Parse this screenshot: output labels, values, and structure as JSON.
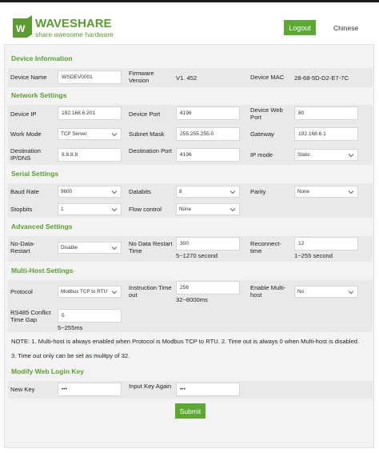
{
  "brand": {
    "name": "WAVESHARE",
    "tagline": "share awesome hardware",
    "color": "#5a9e2f"
  },
  "header": {
    "logout_label": "Logout",
    "language_label": "Chinese"
  },
  "device_info": {
    "title": "Device Information",
    "name_label": "Device Name",
    "name_value": "WSDEV0001",
    "firmware_label": "Firmware Version",
    "firmware_value": "V1. 452",
    "mac_label": "Device MAC",
    "mac_value": "28-68-5D-D2-E7-7C"
  },
  "network": {
    "title": "Network Settings",
    "ip_label": "Device IP",
    "ip_value": "192.168.6.201",
    "port_label": "Device Port",
    "port_value": "4196",
    "webport_label": "Device Web Port",
    "webport_value": "80",
    "workmode_label": "Work Mode",
    "workmode_value": "TCP Server",
    "subnet_label": "Subnet Mask",
    "subnet_value": "255.255.255.0",
    "gateway_label": "Gateway",
    "gateway_value": "192.168.6.1",
    "destip_label": "Destination IP/DNS",
    "destip_value": "8.8.8.8",
    "destport_label": "Destination Port",
    "destport_value": "4196",
    "ipmode_label": "IP mode",
    "ipmode_value": "Static"
  },
  "serial": {
    "title": "Serial Settings",
    "baud_label": "Baud Rate",
    "baud_value": "9600",
    "databits_label": "Databits",
    "databits_value": "8",
    "parity_label": "Parity",
    "parity_value": "None",
    "stopbits_label": "Stopbits",
    "stopbits_value": "1",
    "flow_label": "Flow control",
    "flow_value": "None"
  },
  "advanced": {
    "title": "Advanced Settings",
    "nodata_label": "No-Data-Restart",
    "nodata_value": "Disable",
    "nodatatime_label": "No Data Restart Time",
    "nodatatime_value": "300",
    "nodatatime_hint": "5~1270 second",
    "reconnect_label": "Reconnect-time",
    "reconnect_value": "12",
    "reconnect_hint": "1~255 second"
  },
  "multihost": {
    "title": "Multi-Host Settings",
    "protocol_label": "Protocol",
    "protocol_value": "Modbus TCP to RTU",
    "timeout_label": "Instruction Time out",
    "timeout_value": "256",
    "timeout_hint": "32~8000ms",
    "enable_label": "Enable Multi-host",
    "enable_value": "No",
    "conflict_label": "RS485 Conflict Time Gap",
    "conflict_value": "5",
    "conflict_hint": "5~255ms",
    "note1": "NOTE: 1. Multi-host is always enabled when Protocol is Modbus TCP to RTU. 2. Time out is always 0 when Multi-host is disabled.",
    "note2": "3. Time out only can be set as mulitpy of 32."
  },
  "login": {
    "title": "Modify Web Login Key",
    "newkey_label": "New Key",
    "newkey_value": "•••",
    "inputkey_label": "Input Key Again",
    "inputkey_value": "•••"
  },
  "submit_label": "Submit"
}
